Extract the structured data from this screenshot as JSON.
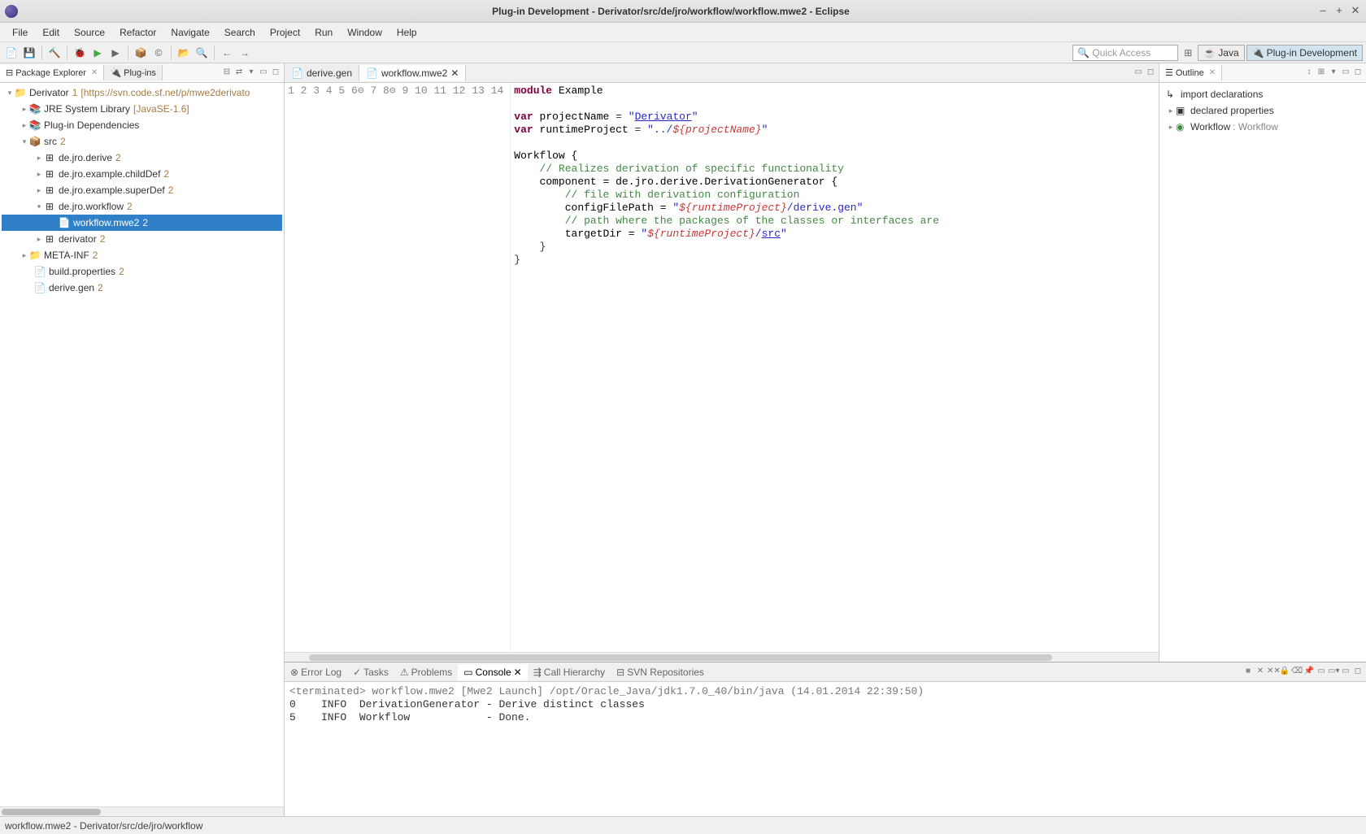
{
  "window": {
    "title": "Plug-in Development - Derivator/src/de/jro/workflow/workflow.mwe2 - Eclipse"
  },
  "menu": [
    "File",
    "Edit",
    "Source",
    "Refactor",
    "Navigate",
    "Search",
    "Project",
    "Run",
    "Window",
    "Help"
  ],
  "quickaccess": {
    "placeholder": "Quick Access",
    "icon": "🔍"
  },
  "perspectives": [
    {
      "icon": "☕",
      "label": "Java"
    },
    {
      "icon": "🔌",
      "label": "Plug-in Development"
    }
  ],
  "package_explorer": {
    "tab_label": "Package Explorer",
    "other_tab": "Plug-ins",
    "project": {
      "name": "Derivator",
      "suffix": "1",
      "url": "[https://svn.code.sf.net/p/mwe2derivato"
    },
    "jre": {
      "label": "JRE System Library",
      "env": "[JavaSE-1.6]"
    },
    "deps": {
      "label": "Plug-in Dependencies"
    },
    "src": {
      "label": "src",
      "suffix": "2"
    },
    "packages": [
      {
        "name": "de.jro.derive",
        "suffix": "2"
      },
      {
        "name": "de.jro.example.childDef",
        "suffix": "2"
      },
      {
        "name": "de.jro.example.superDef",
        "suffix": "2"
      },
      {
        "name": "de.jro.workflow",
        "suffix": "2"
      }
    ],
    "selected_file": {
      "name": "workflow.mwe2",
      "suffix": "2"
    },
    "pkg_derivator": {
      "name": "derivator",
      "suffix": "2"
    },
    "metainf": {
      "name": "META-INF",
      "suffix": "2"
    },
    "build": {
      "name": "build.properties",
      "suffix": "2"
    },
    "derivegen": {
      "name": "derive.gen",
      "suffix": "2"
    }
  },
  "editor": {
    "tabs": [
      {
        "icon": "📄",
        "label": "derive.gen"
      },
      {
        "icon": "📄",
        "label": "workflow.mwe2"
      }
    ],
    "active_tab": 1,
    "code": {
      "l1": {
        "kw": "module",
        "name": "Example"
      },
      "l3": {
        "kw": "var",
        "name": "projectName",
        "eq": " = ",
        "strOpen": "\"",
        "strVal": "Derivator",
        "strClose": "\""
      },
      "l4": {
        "kw": "var",
        "name": "runtimeProject",
        "eq": " = ",
        "strOpen": "\"../",
        "varRef": "${projectName}",
        "strClose": "\""
      },
      "l6": {
        "name": "Workflow {"
      },
      "l7": {
        "cmt": "// Realizes derivation of specific functionality"
      },
      "l8": {
        "name": "component = de.jro.derive.DerivationGenerator {"
      },
      "l9": {
        "cmt": "// file with derivation configuration"
      },
      "l10": {
        "name": "configFilePath = ",
        "strOpen": "\"",
        "varRef": "${runtimeProject}",
        "strMid": "/derive.gen",
        "strClose": "\""
      },
      "l11": {
        "cmt": "// path where the packages of the classes or interfaces are"
      },
      "l12": {
        "name": "targetDir = ",
        "strOpen": "\"",
        "varRef": "${runtimeProject}",
        "strMid": "/",
        "src": "src",
        "strClose": "\""
      },
      "l13": "    }",
      "l14": "}"
    }
  },
  "console": {
    "tabs": [
      "Error Log",
      "Tasks",
      "Problems",
      "Console",
      "Call Hierarchy",
      "SVN Repositories"
    ],
    "active": 3,
    "header": "<terminated> workflow.mwe2 [Mwe2 Launch] /opt/Oracle_Java/jdk1.7.0_40/bin/java (14.01.2014 22:39:50)",
    "lines": [
      "0    INFO  DerivationGenerator - Derive distinct classes",
      "5    INFO  Workflow            - Done."
    ]
  },
  "outline": {
    "tab_label": "Outline",
    "nodes": [
      {
        "icon": "↳",
        "label": "import declarations"
      },
      {
        "icon": "▣",
        "label": "declared properties"
      },
      {
        "icon": "◉",
        "label": "Workflow",
        "type": ": Workflow"
      }
    ]
  },
  "status": "workflow.mwe2 - Derivator/src/de/jro/workflow"
}
